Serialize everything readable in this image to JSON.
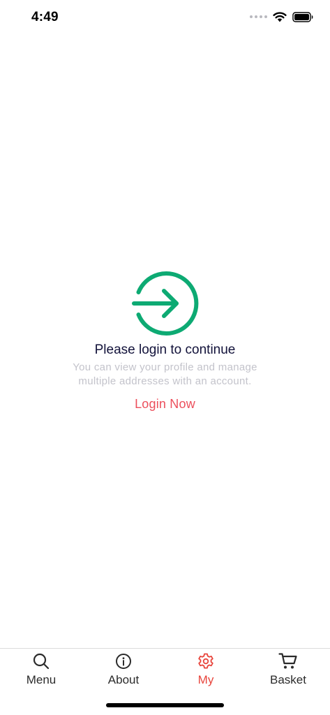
{
  "status_bar": {
    "time": "4:49",
    "icons": [
      "signal-dots-icon",
      "wifi-icon",
      "battery-icon"
    ]
  },
  "empty_state": {
    "icon": "login-arrow-icon",
    "icon_color": "#0daa73",
    "title": "Please login to continue",
    "description": "You can view your profile and manage multiple addresses with an account.",
    "action_label": "Login Now",
    "action_color": "#ec4f5c"
  },
  "tab_bar": {
    "active_color": "#e8453c",
    "tabs": [
      {
        "label": "Menu",
        "icon": "search-icon",
        "active": false
      },
      {
        "label": "About",
        "icon": "info-icon",
        "active": false
      },
      {
        "label": "My",
        "icon": "gear-icon",
        "active": true
      },
      {
        "label": "Basket",
        "icon": "cart-icon",
        "active": false
      }
    ]
  }
}
